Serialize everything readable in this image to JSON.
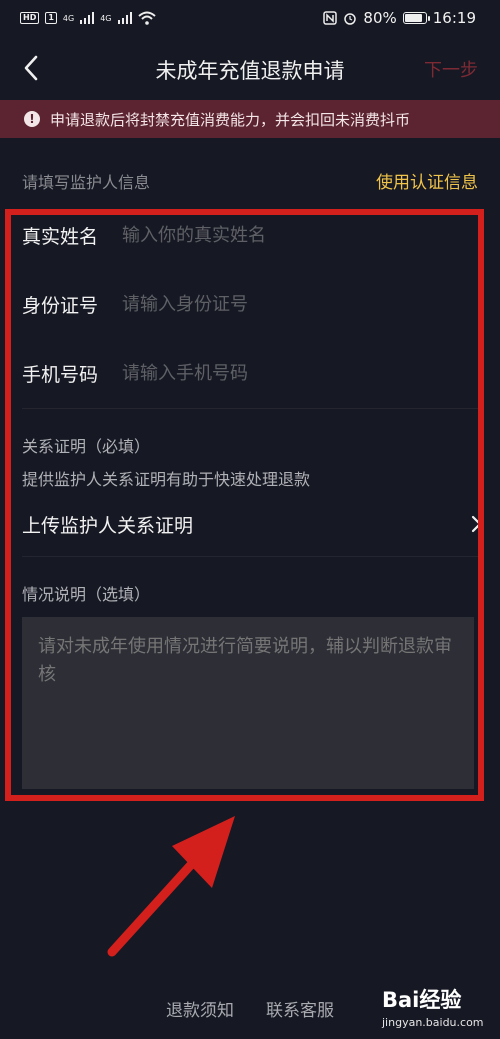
{
  "status": {
    "left_badges": [
      "HD",
      "1",
      "4G",
      "4G"
    ],
    "battery": "80%",
    "time": "16:19"
  },
  "nav": {
    "title": "未成年充值退款申请",
    "next_label": "下一步"
  },
  "banner": {
    "text": "申请退款后将封禁充值消费能力，并会扣回未消费抖币"
  },
  "guardian": {
    "section_label": "请填写监护人信息",
    "use_cert_label": "使用认证信息",
    "fields": [
      {
        "label": "真实姓名",
        "placeholder": "输入你的真实姓名"
      },
      {
        "label": "身份证号",
        "placeholder": "请输入身份证号"
      },
      {
        "label": "手机号码",
        "placeholder": "请输入手机号码"
      }
    ]
  },
  "relation": {
    "title": "关系证明（必填）",
    "hint": "提供监护人关系证明有助于快速处理退款",
    "upload_label": "上传监护人关系证明"
  },
  "situation": {
    "title": "情况说明（选填）",
    "placeholder": "请对未成年使用情况进行简要说明，辅以判断退款审核"
  },
  "footer": {
    "refund_notice": "退款须知",
    "contact_service": "联系客服"
  },
  "watermark": {
    "brand": "Bai经验",
    "url": "jingyan.baidu.com"
  },
  "colors": {
    "background": "#161823",
    "banner": "#5c2330",
    "accent": "#f0c34a",
    "highlight": "#d3201d"
  }
}
